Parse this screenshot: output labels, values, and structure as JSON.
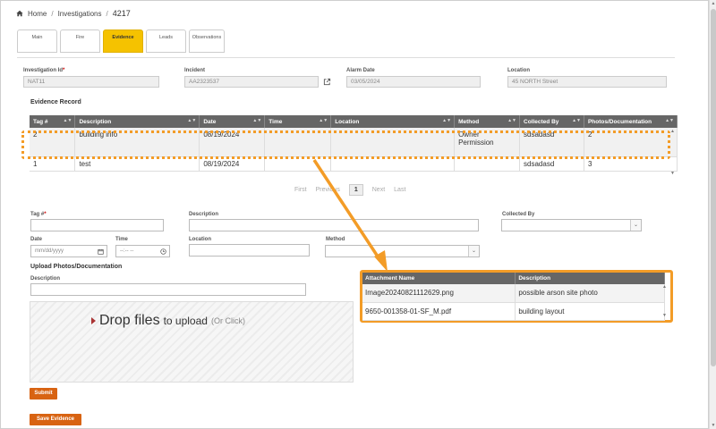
{
  "breadcrumb": {
    "home": "Home",
    "investigations": "Investigations",
    "current": "4217"
  },
  "tabs": [
    "Main",
    "Fire",
    "Evidence",
    "Leads",
    "Observations"
  ],
  "header_fields": {
    "investigation_id": {
      "label": "Investigation Id",
      "value": "NAT11"
    },
    "incident": {
      "label": "Incident",
      "value": "AA2323537"
    },
    "alarm_date": {
      "label": "Alarm Date",
      "value": "03/05/2024"
    },
    "location": {
      "label": "Location",
      "value": "45  NORTH Street"
    }
  },
  "evidence_record": {
    "title": "Evidence Record",
    "columns": [
      "Tag #",
      "Description",
      "Date",
      "Time",
      "Location",
      "Method",
      "Collected By",
      "Photos/Documentation"
    ],
    "rows": [
      {
        "tag": "2",
        "description": "building info",
        "date": "08/19/2024",
        "time": "",
        "location": "",
        "method": "Owner Permission",
        "collected_by": "sdsadasd",
        "photos": "2"
      },
      {
        "tag": "1",
        "description": "test",
        "date": "08/19/2024",
        "time": "",
        "location": "",
        "method": "",
        "collected_by": "sdsadasd",
        "photos": "3"
      }
    ]
  },
  "pager": {
    "first": "First",
    "previous": "Previous",
    "page": "1",
    "next": "Next",
    "last": "Last"
  },
  "form": {
    "tag_label": "Tag #",
    "description_label": "Description",
    "collected_by_label": "Collected By",
    "date_label": "Date",
    "date_placeholder": "mm/dd/yyyy",
    "time_label": "Time",
    "time_placeholder": "--:-- --",
    "location_label": "Location",
    "method_label": "Method"
  },
  "upload": {
    "title": "Upload Photos/Documentation",
    "description_label": "Description",
    "drop_main": "Drop files",
    "drop_sub": "to upload",
    "drop_hint": "(Or Click)"
  },
  "attachments": {
    "columns": [
      "Attachment Name",
      "Description"
    ],
    "rows": [
      {
        "name": "Image20240821112629.png",
        "description": "possible arson site photo"
      },
      {
        "name": "9650-001358-01-SF_M.pdf",
        "description": "building layout"
      }
    ]
  },
  "buttons": {
    "submit": "Submit",
    "save_evidence": "Save Evidence"
  },
  "colors": {
    "accent": "#f5c200",
    "highlight": "#f39c27",
    "button": "#d86312",
    "table_header": "#666666"
  }
}
